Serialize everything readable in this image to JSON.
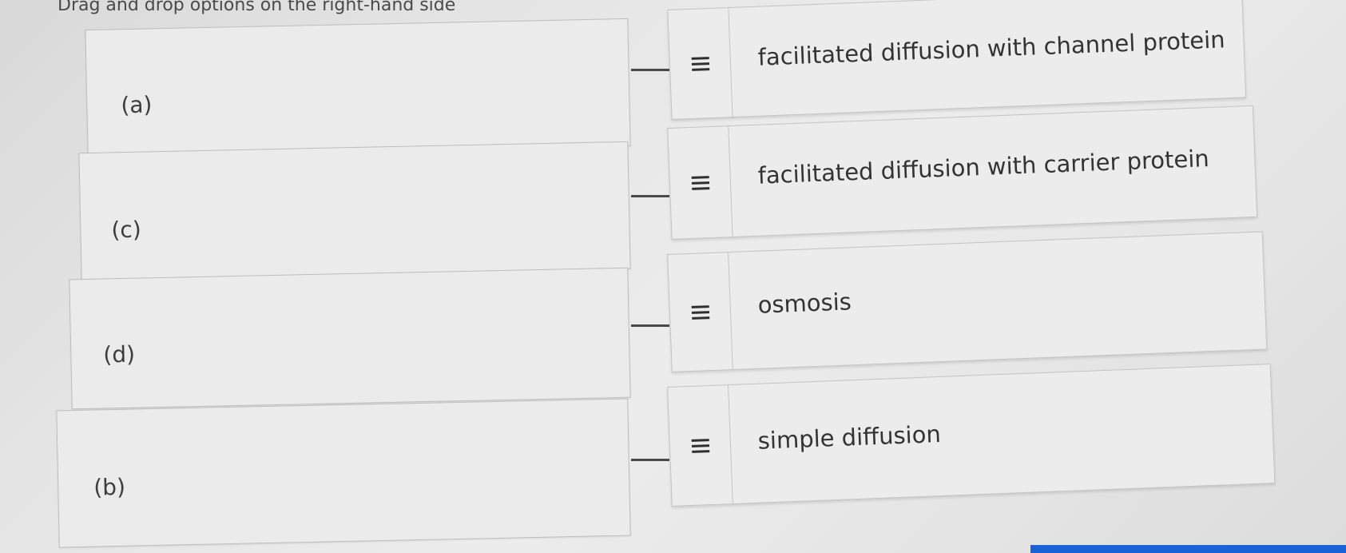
{
  "instructions": "Drag and drop options on the right-hand side",
  "slots": [
    {
      "label": "(a)"
    },
    {
      "label": "(c)"
    },
    {
      "label": "(d)"
    },
    {
      "label": "(b)"
    }
  ],
  "options": [
    {
      "text": "facilitated diffusion with channel protein",
      "handle_icon": "drag-handle-icon"
    },
    {
      "text": "facilitated diffusion with carrier protein",
      "handle_icon": "drag-handle-icon"
    },
    {
      "text": "osmosis",
      "handle_icon": "drag-handle-icon"
    },
    {
      "text": "simple diffusion",
      "handle_icon": "drag-handle-icon"
    }
  ],
  "colors": {
    "accent_bar": "#1a63d6"
  }
}
